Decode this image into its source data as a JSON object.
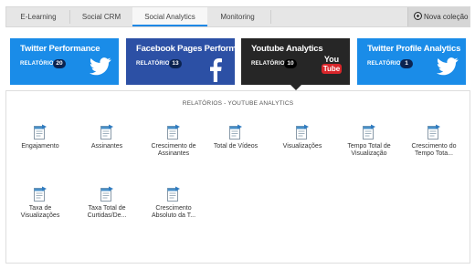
{
  "tabs": [
    {
      "label": "E-Learning"
    },
    {
      "label": "Social CRM"
    },
    {
      "label": "Social Analytics"
    },
    {
      "label": "Monitoring"
    }
  ],
  "new_collection_label": "Nova coleção",
  "cards": [
    {
      "title": "Twitter Performance",
      "relatorios_label": "RELATÓRIOS",
      "count": "20",
      "icon": "twitter-icon"
    },
    {
      "title": "Facebook Pages Performance",
      "relatorios_label": "RELATÓRIOS",
      "count": "13",
      "icon": "facebook-icon"
    },
    {
      "title": "Youtube Analytics",
      "relatorios_label": "RELATÓRIOS",
      "count": "10",
      "icon": "youtube-icon",
      "logo_top": "You",
      "logo_bottom": "Tube"
    },
    {
      "title": "Twitter Profile Analytics",
      "relatorios_label": "RELATÓRIOS",
      "count": "1",
      "icon": "twitter-icon"
    }
  ],
  "panel": {
    "title": "RELATÓRIOS - YOUTUBE ANALYTICS",
    "reports": [
      [
        "Engajamento"
      ],
      [
        "Assinantes"
      ],
      [
        "Crescimento de",
        "Assinantes"
      ],
      [
        "Total de Vídeos"
      ],
      [
        "Visualizações"
      ],
      [
        "Tempo Total de",
        "Visualização"
      ],
      [
        "Crescimento do",
        "Tempo Tota..."
      ],
      [
        "Taxa de",
        "Visualizações"
      ],
      [
        "Taxa Total de",
        "Curtidas/De..."
      ],
      [
        "Crescimento",
        "Absoluto da T..."
      ]
    ]
  },
  "colors": {
    "twitter": "#1a8ce8",
    "facebook": "#2c50a5",
    "youtube": "#262626",
    "active_tab_underline": "#1e88e5"
  }
}
